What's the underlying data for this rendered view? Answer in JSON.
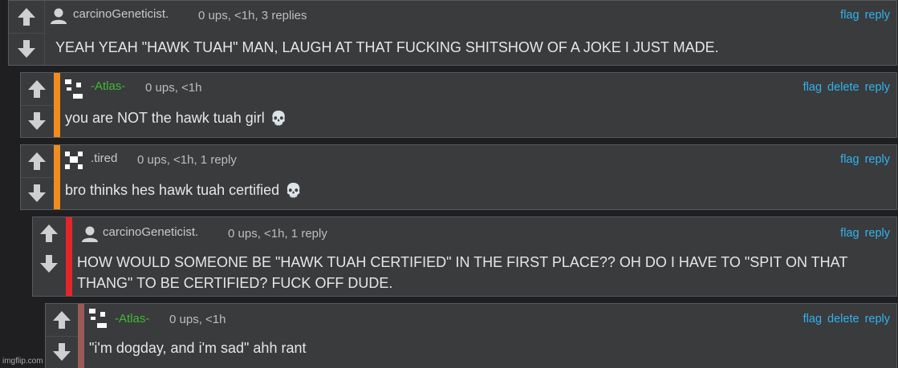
{
  "comments": [
    {
      "username": "carcinoGeneticist.",
      "meta": "0 ups, <1h, 3 replies",
      "actions": [
        "flag",
        "reply"
      ],
      "body": "YEAH YEAH \"HAWK TUAH\" MAN, LAUGH AT THAT FUCKING SHITSHOW OF A JOKE I JUST MADE.",
      "avatar": "person-icon",
      "username_color": "#c9c9c9"
    },
    {
      "username": "-Atlas-",
      "meta": "0 ups, <1h",
      "actions": [
        "flag",
        "delete",
        "reply"
      ],
      "body": "you are NOT the hawk tuah girl",
      "emoji": "💀",
      "avatar": "pixel-avatar",
      "username_color": "#41b935",
      "stripe_color": "#f28c1c"
    },
    {
      "username": ".tired",
      "meta": "0 ups, <1h, 1 reply",
      "actions": [
        "flag",
        "reply"
      ],
      "body": "bro thinks hes hawk tuah certified",
      "emoji": "💀",
      "avatar": "pixel-avatar",
      "username_color": "#c9c9c9",
      "stripe_color": "#f28c1c"
    },
    {
      "username": "carcinoGeneticist.",
      "meta": "0 ups, <1h, 1 reply",
      "actions": [
        "flag",
        "reply"
      ],
      "body": "HOW WOULD SOMEONE BE \"HAWK TUAH CERTIFIED\" IN THE FIRST PLACE?? OH DO I HAVE TO \"SPIT ON THAT THANG\" TO BE CERTIFIED? FUCK OFF DUDE.",
      "avatar": "person-icon",
      "username_color": "#c9c9c9",
      "stripe_color": "#e4262a"
    },
    {
      "username": "-Atlas-",
      "meta": "0 ups, <1h",
      "actions": [
        "flag",
        "delete",
        "reply"
      ],
      "body": "\"i'm dogday, and i'm sad\" ahh rant",
      "avatar": "pixel-avatar",
      "username_color": "#41b935",
      "stripe_color": "#9a5a58"
    }
  ],
  "watermark": "imgflip.com"
}
